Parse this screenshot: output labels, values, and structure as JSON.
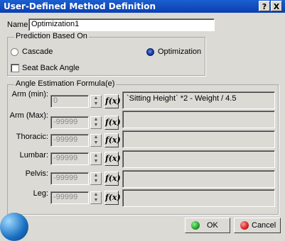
{
  "window": {
    "title": "User-Defined Method Definition",
    "help_glyph": "?",
    "close_glyph": "X"
  },
  "name": {
    "label": "Name",
    "value": "Optimization1"
  },
  "prediction": {
    "legend": "Prediction Based On",
    "cascade_label": "Cascade",
    "optimization_label": "Optimization",
    "selected": "Optimization",
    "seat_back_label": "Seat Back Angle",
    "seat_back_checked": false
  },
  "angles": {
    "legend": "Angle Estimation Formula(e)",
    "fx_label": "f(x)",
    "rows": [
      {
        "label": "Arm (min):",
        "value": "0",
        "formula": "`Sitting Height` *2 - Weight / 4.5"
      },
      {
        "label": "Arm (Max):",
        "value": "-99999",
        "formula": ""
      },
      {
        "label": "Thoracic:",
        "value": "-99999",
        "formula": ""
      },
      {
        "label": "Lumbar:",
        "value": "-99999",
        "formula": ""
      },
      {
        "label": "Pelvis:",
        "value": "-99999",
        "formula": ""
      },
      {
        "label": "Leg:",
        "value": "-99999",
        "formula": ""
      }
    ]
  },
  "buttons": {
    "ok": "OK",
    "cancel": "Cancel"
  },
  "colors": {
    "titlebar": "#0a3fb0",
    "ok_icon": "#1fa12b",
    "cancel_icon": "#d42020"
  }
}
